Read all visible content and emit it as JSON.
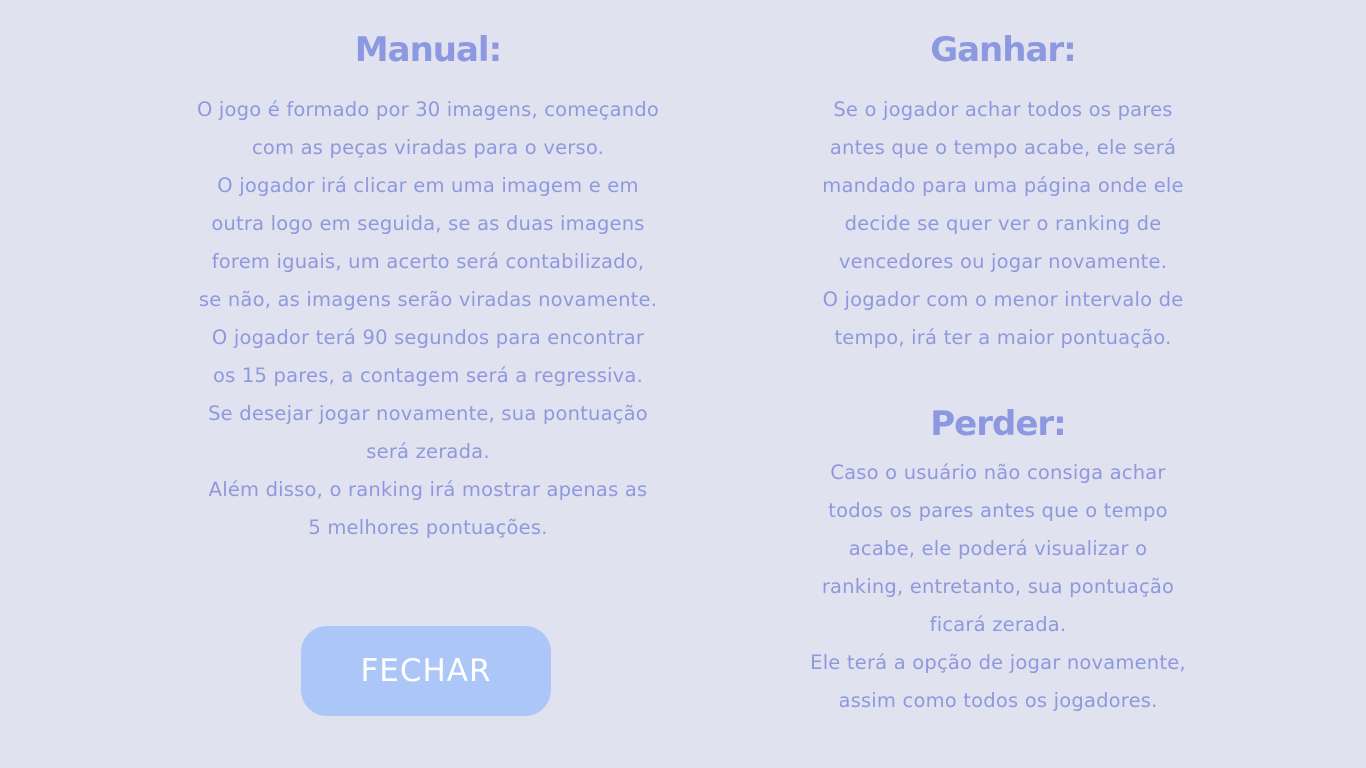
{
  "manual": {
    "title": "Manual:",
    "lines": [
      "O jogo é formado por 30 imagens, começando",
      "com as peças viradas para o verso.",
      "O jogador irá clicar em uma imagem e em",
      "outra logo em seguida, se as duas imagens",
      "forem iguais, um acerto será contabilizado,",
      "se não, as imagens serão viradas novamente.",
      "O jogador terá 90 segundos para encontrar",
      "os 15 pares, a contagem será a regressiva.",
      "Se desejar jogar novamente, sua pontuação",
      "será zerada.",
      "Além disso, o ranking irá mostrar apenas as",
      "5 melhores pontuações."
    ]
  },
  "ganhar": {
    "title": "Ganhar:",
    "lines": [
      "Se o jogador achar todos os pares",
      "antes que o tempo acabe, ele será",
      "mandado para uma página onde ele",
      "decide se quer ver o ranking de",
      "vencedores ou jogar novamente.",
      "O jogador com o menor intervalo de",
      "tempo, irá ter a maior pontuação."
    ]
  },
  "perder": {
    "title": "Perder:",
    "lines": [
      "Caso o usuário não consiga achar",
      "todos os pares antes que o tempo",
      "acabe, ele poderá visualizar o",
      "ranking, entretanto, sua pontuação",
      "ficará zerada.",
      "Ele terá a opção de jogar novamente,",
      "assim como todos os jogadores."
    ]
  },
  "close_button": {
    "label": "FECHAR"
  },
  "colors": {
    "background": "#e1e2ef",
    "heading": "#8c98e0",
    "text": "#8e99dd",
    "button": "#abc6f7",
    "button_text": "#ffffff"
  }
}
